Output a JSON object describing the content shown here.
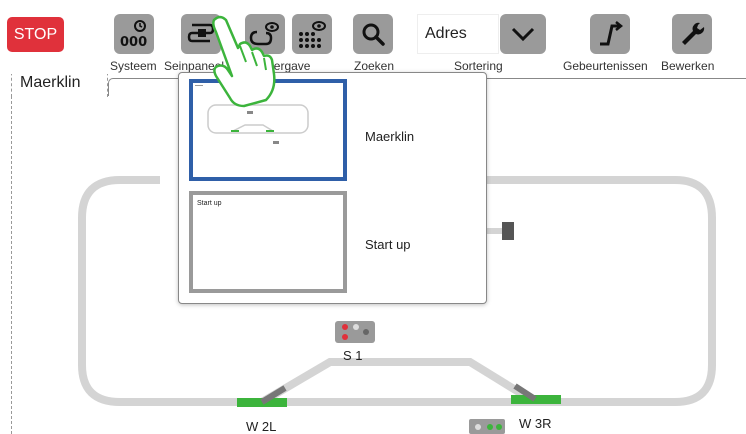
{
  "toolbar": {
    "stop_label": "STOP",
    "buttons": [
      {
        "id": "systeem",
        "label": "Systeem"
      },
      {
        "id": "seinpaneel",
        "label": "Seinpaneel"
      },
      {
        "id": "weergave",
        "label": "Weergave"
      },
      {
        "id": "zoeken",
        "label": "Zoeken"
      },
      {
        "id": "sortering",
        "label": "Sortering"
      },
      {
        "id": "gebeurtenissen",
        "label": "Gebeurtenissen"
      },
      {
        "id": "bewerken",
        "label": "Bewerken"
      }
    ],
    "sort_value": "Adres"
  },
  "tab": {
    "label": "Maerklin"
  },
  "layouts": [
    {
      "name": "Maerklin",
      "selected": true
    },
    {
      "name": "Start up",
      "thumb_title": "Start up",
      "selected": false
    }
  ],
  "track": {
    "signal_label": "S 1",
    "switch_left": "W 2L",
    "switch_right": "W 3R"
  },
  "colors": {
    "stop": "#e0313b",
    "selected_border": "#2f5fa8",
    "track": "#d4d4d4",
    "switch": "#3cb43c",
    "button": "#9a9a9a"
  }
}
